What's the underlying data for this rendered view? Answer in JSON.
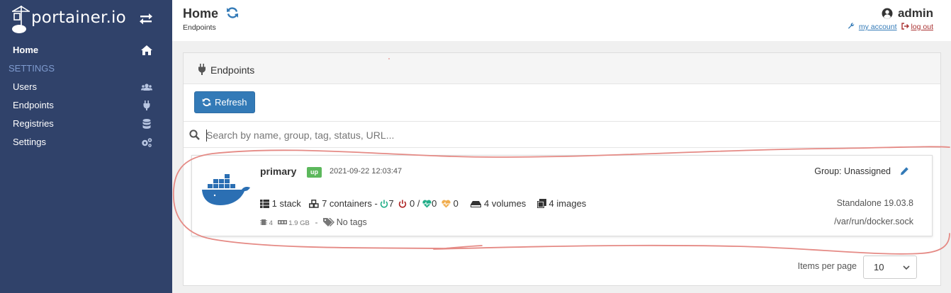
{
  "app": {
    "brand": "portainer.io"
  },
  "sidebar": {
    "home_label": "Home",
    "settings_heading": "SETTINGS",
    "items": [
      {
        "label": "Users",
        "icon": "users-icon"
      },
      {
        "label": "Endpoints",
        "icon": "plug-icon"
      },
      {
        "label": "Registries",
        "icon": "database-icon"
      },
      {
        "label": "Settings",
        "icon": "cogs-icon"
      }
    ]
  },
  "header": {
    "title": "Home",
    "breadcrumb": "Endpoints",
    "username": "admin",
    "my_account": "my account",
    "log_out": "log out"
  },
  "panel": {
    "title": "Endpoints",
    "refresh_label": "Refresh",
    "search_placeholder": "Search by name, group, tag, status, URL..."
  },
  "endpoint": {
    "name": "primary",
    "status": "up",
    "timestamp": "2021-09-22 12:03:47",
    "group": "Group: Unassigned",
    "stacks": "1 stack",
    "containers": "7 containers",
    "dash": "-",
    "running": "7",
    "stopped": "0",
    "slash": "/",
    "healthy": "0",
    "unhealthy": "0",
    "volumes": "4 volumes",
    "images": "4 images",
    "cpus": "4",
    "memory": "1.9 GB",
    "meta_dash": "-",
    "tags": "No tags",
    "version": "Standalone 19.03.8",
    "url": "/var/run/docker.sock"
  },
  "pagination": {
    "label": "Items per page",
    "selected": "10"
  },
  "colors": {
    "sidebar_bg": "#30426a",
    "primary": "#337ab7",
    "up_badge": "#5cb85c",
    "running": "#23ae89",
    "stopped": "#ae2323",
    "unhealthy": "#f0ad4e",
    "docker_blue": "#2b6fb3",
    "markup": "#e58a85"
  }
}
